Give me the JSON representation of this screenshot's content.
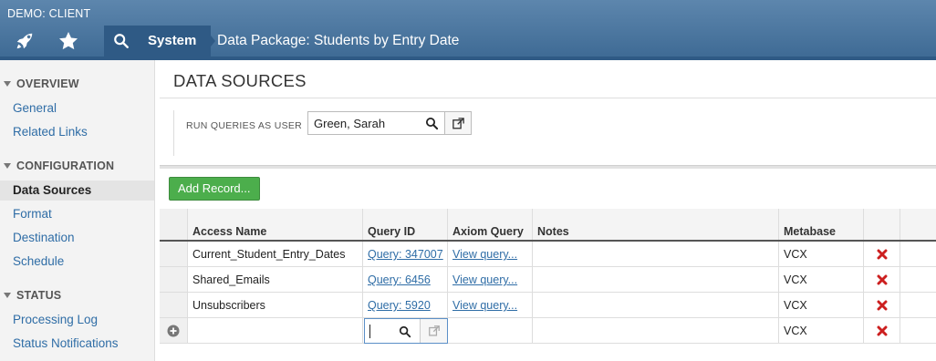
{
  "app": {
    "client_label": "DEMO: CLIENT",
    "breadcrumb": "System",
    "page_title": "Data Package: Students by Entry Date"
  },
  "sidebar": {
    "sections": [
      {
        "heading": "OVERVIEW",
        "items": [
          "General",
          "Related Links"
        ]
      },
      {
        "heading": "CONFIGURATION",
        "items": [
          "Data Sources",
          "Format",
          "Destination",
          "Schedule"
        ]
      },
      {
        "heading": "STATUS",
        "items": [
          "Processing Log",
          "Status Notifications"
        ]
      }
    ],
    "active_item": "Data Sources"
  },
  "main": {
    "section_title": "DATA SOURCES",
    "run_as_label": "RUN QUERIES AS USER",
    "run_as_value": "Green, Sarah",
    "add_record_label": "Add Record..."
  },
  "table": {
    "columns": [
      "",
      "Access Name",
      "Query ID",
      "Axiom Query",
      "Notes",
      "Metabase",
      "",
      ""
    ],
    "rows": [
      {
        "access_name": "Current_Student_Entry_Dates",
        "query_id": "Query: 347007",
        "axiom_query": "View query...",
        "notes": "",
        "metabase": "VCX"
      },
      {
        "access_name": "Shared_Emails",
        "query_id": "Query: 6456",
        "axiom_query": "View query...",
        "notes": "",
        "metabase": "VCX"
      },
      {
        "access_name": "Unsubscribers",
        "query_id": "Query: 5920",
        "axiom_query": "View query...",
        "notes": "",
        "metabase": "VCX"
      }
    ],
    "new_row": {
      "metabase": "VCX"
    }
  },
  "colors": {
    "topbar": "#4a77a2",
    "link": "#2f6da6",
    "add_button": "#4cae4c",
    "delete_icon": "#cc1f1f"
  }
}
